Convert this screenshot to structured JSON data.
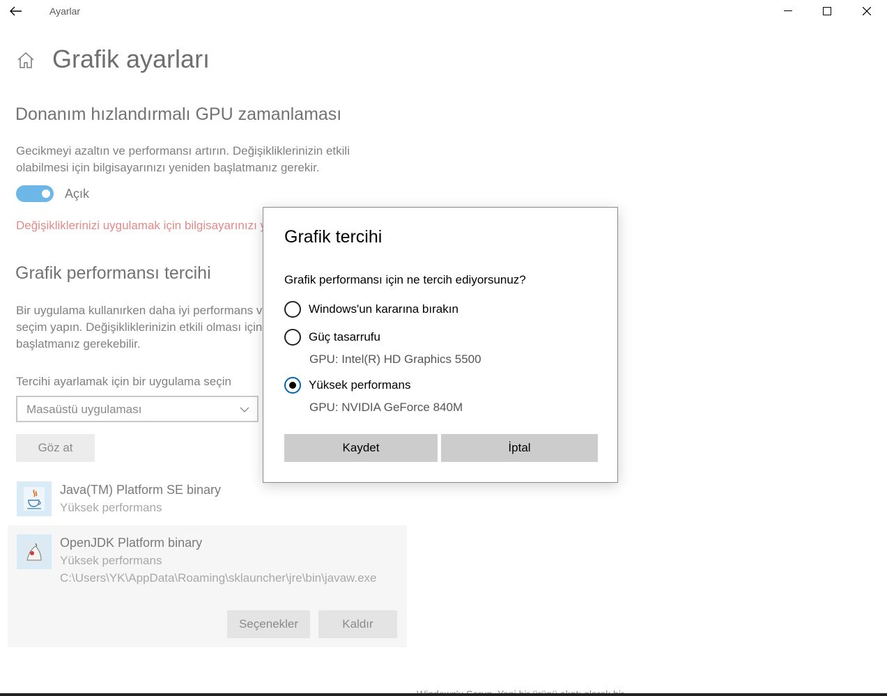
{
  "window": {
    "title": "Ayarlar",
    "minimize_glyph": "—",
    "close_glyph": "✕"
  },
  "page": {
    "title": "Grafik ayarları"
  },
  "gpu_scheduling": {
    "heading": "Donanım hızlandırmalı GPU zamanlaması",
    "description_line1": "Gecikmeyi azaltın ve performansı artırın. Değişikliklerinizin etkili",
    "description_line2": "olabilmesi için bilgisayarınızı yeniden başlatmanız gerekir.",
    "toggle_state": "on",
    "toggle_label": "Açık",
    "warning": "Değişikliklerinizi uygulamak için bilgisayarınızı yeniden başlatın."
  },
  "graphics_pref": {
    "heading": "Grafik performansı tercihi",
    "description_line1": "Bir uygulama kullanırken daha iyi performans v",
    "description_line2": "seçim yapın. Değişikliklerinizin etkili olması için",
    "description_line3": "başlatmanız gerekebilir.",
    "select_label": "Tercihi ayarlamak için bir uygulama seçin",
    "select_value": "Masaüstü uygulaması",
    "browse_label": "Göz at"
  },
  "apps": [
    {
      "name": "Java(TM) Platform SE binary",
      "preference": "Yüksek performans",
      "icon": "java-icon"
    },
    {
      "name": "OpenJDK Platform binary",
      "preference": "Yüksek performans",
      "path": "C:\\Users\\YK\\AppData\\Roaming\\sklauncher\\jre\\bin\\javaw.exe",
      "icon": "openjdk-icon",
      "options_label": "Seçenekler",
      "remove_label": "Kaldır"
    }
  ],
  "dialog": {
    "title": "Grafik tercihi",
    "question": "Grafik performansı için ne tercih ediyorsunuz?",
    "options": [
      {
        "label": "Windows'un kararına bırakın",
        "checked": false
      },
      {
        "label": "Güç tasarrufu",
        "gpu": "GPU: Intel(R) HD Graphics 5500",
        "checked": false
      },
      {
        "label": "Yüksek performans",
        "gpu": "GPU: NVIDIA GeForce 840M",
        "checked": true
      }
    ],
    "save_label": "Kaydet",
    "cancel_label": "İptal"
  },
  "background_text": "Windows'u Sorun. Yeni bir ürünü alıntı olarak bir ....",
  "colors": {
    "accent": "#0063b1",
    "toggle_on": "#6cb6e8",
    "warning": "#e38a8a"
  }
}
